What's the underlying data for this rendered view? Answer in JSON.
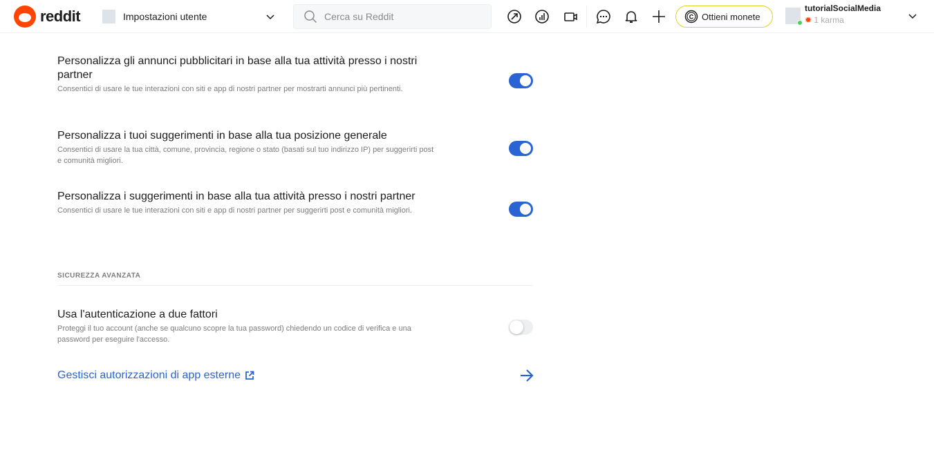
{
  "header": {
    "logo_text": "reddit",
    "nav_label": "Impostazioni utente",
    "search_placeholder": "Cerca su Reddit",
    "coins_label": "Ottieni monete",
    "username": "tutorialSocialMedia",
    "karma": "1 karma"
  },
  "settings": [
    {
      "title": "Personalizza gli annunci pubblicitari in base alla tua attività presso i nostri partner",
      "desc": "Consentici di usare le tue interazioni con siti e app di nostri partner per mostrarti annunci più pertinenti.",
      "enabled": true
    },
    {
      "title": "Personalizza i tuoi suggerimenti in base alla tua posizione generale",
      "desc": "Consentici di usare la tua città, comune, provincia, regione o stato (basati sul tuo indirizzo IP) per suggerirti post e comunità migliori.",
      "enabled": true
    },
    {
      "title": "Personalizza i suggerimenti in base alla tua attività presso i nostri partner",
      "desc": "Consentici di usare le tue interazioni con siti e app di nostri partner per suggerirti post e comunità migliori.",
      "enabled": true
    }
  ],
  "security": {
    "section_title": "SICUREZZA AVANZATA",
    "twofa_title": "Usa l'autenticazione a due fattori",
    "twofa_desc": "Proteggi il tuo account (anche se qualcuno scopre la tua password) chiedendo un codice di verifica e una password per eseguire l'accesso.",
    "twofa_enabled": false,
    "link_label": "Gestisci autorizzazioni di app esterne"
  },
  "colors": {
    "accent": "#2a63d4",
    "brand": "#ff4500"
  }
}
